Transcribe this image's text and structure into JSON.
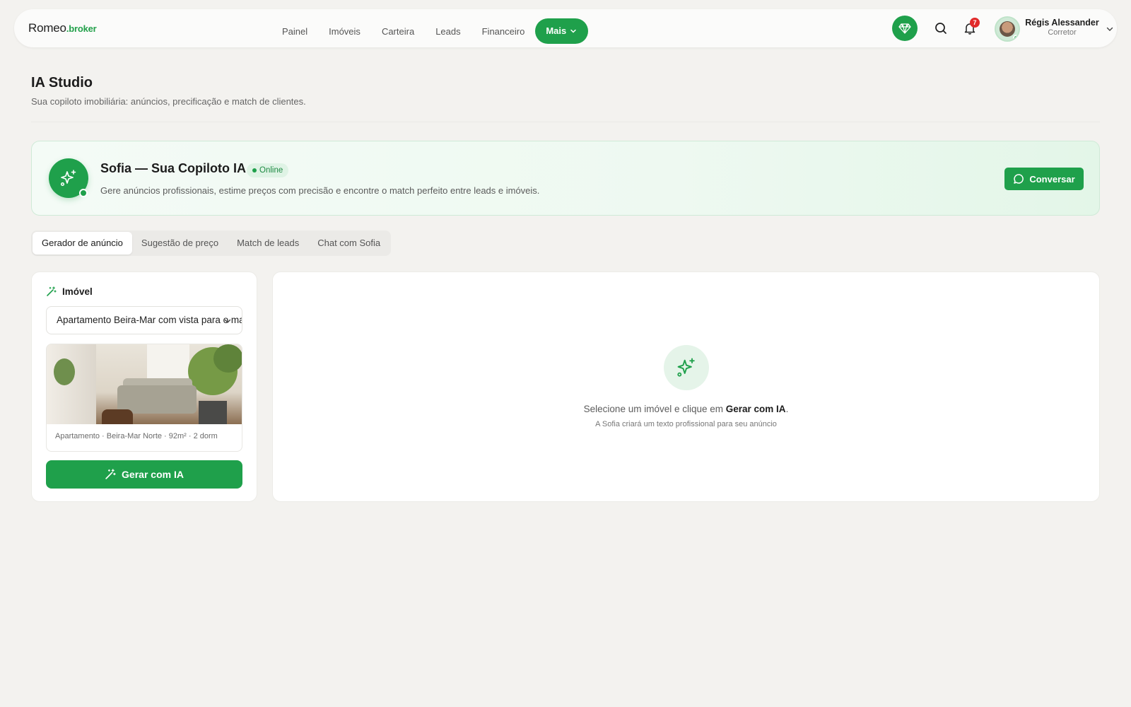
{
  "brand": {
    "name": "Romeo",
    "suffix": ".broker"
  },
  "nav": {
    "items": [
      "Painel",
      "Imóveis",
      "Carteira",
      "Leads",
      "Financeiro"
    ],
    "more_label": "Mais"
  },
  "notifications": {
    "count": "7"
  },
  "user": {
    "name": "Régis Alessander",
    "role": "Corretor"
  },
  "page": {
    "title": "IA Studio",
    "subtitle": "Sua copiloto imobiliária: anúncios, precificação e match de clientes."
  },
  "banner": {
    "title": "Sofia — Sua Copiloto IA",
    "status": "Online",
    "description": "Gere anúncios profissionais, estime preços com precisão e encontre o match perfeito entre leads e imóveis.",
    "button_label": "Conversar"
  },
  "tabs": [
    {
      "label": "Gerador de anúncio",
      "active": true
    },
    {
      "label": "Sugestão de preço",
      "active": false
    },
    {
      "label": "Match de leads",
      "active": false
    },
    {
      "label": "Chat com Sofia",
      "active": false
    }
  ],
  "property_panel": {
    "heading": "Imóvel",
    "selected": "Apartamento Beira-Mar com vista para o mar",
    "meta": "Apartamento · Beira-Mar Norte · 92m² · 2 dorm",
    "generate_label": "Gerar com IA"
  },
  "empty_state": {
    "text_prefix": "Selecione um imóvel e clique em ",
    "text_bold": "Gerar com IA",
    "text_suffix": ".",
    "subtext": "A Sofia criará um texto profissional para seu anúncio"
  },
  "colors": {
    "accent": "#1fa04b",
    "background": "#f3f2ef",
    "badge": "#e12a2a"
  },
  "icons": [
    "diamond-icon",
    "search-icon",
    "bell-icon",
    "chevron-down-icon",
    "sparkles-icon",
    "chat-bubble-icon",
    "wand-icon"
  ]
}
